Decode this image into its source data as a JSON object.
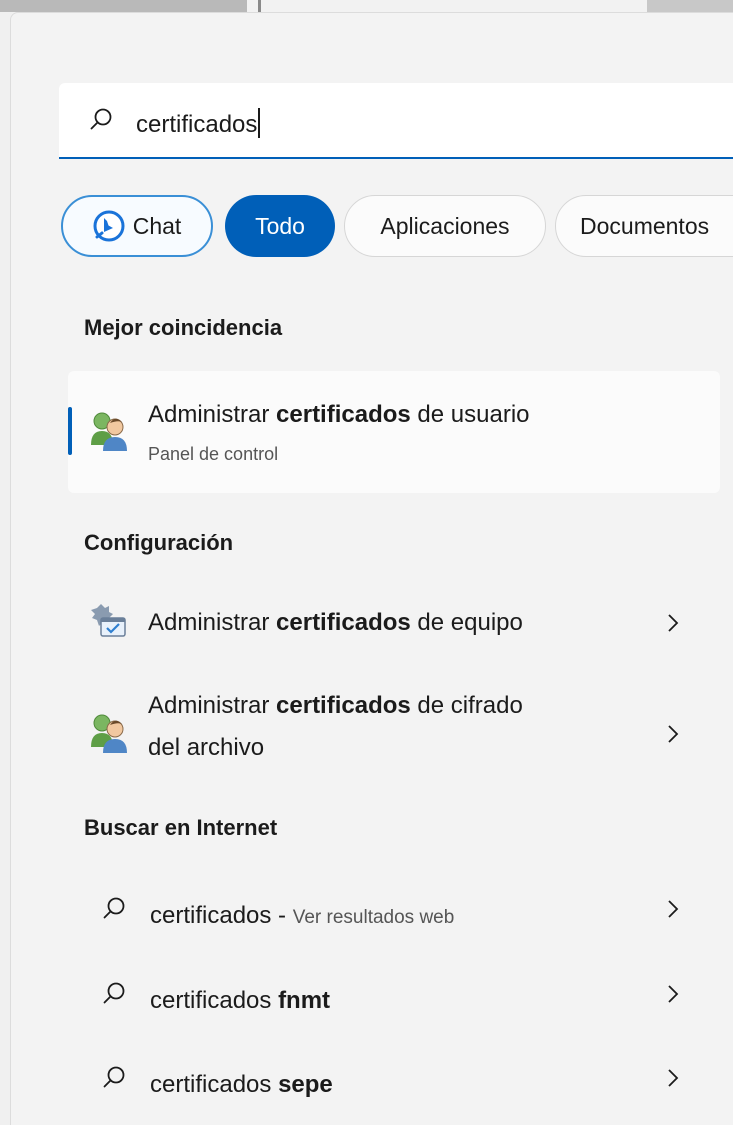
{
  "search": {
    "query": "certificados",
    "icon": "search-icon"
  },
  "filters": [
    {
      "label": "Chat",
      "icon": "bing-chat-icon",
      "active": false
    },
    {
      "label": "Todo",
      "active": true
    },
    {
      "label": "Aplicaciones",
      "active": false
    },
    {
      "label": "Documentos",
      "active": false
    }
  ],
  "best_match": {
    "heading": "Mejor coincidencia",
    "item": {
      "pre": "Administrar ",
      "bold": "certificados",
      "post": " de usuario",
      "subtitle": "Panel de control",
      "icon": "users-icon"
    }
  },
  "settings": {
    "heading": "Configuración",
    "items": [
      {
        "pre": "Administrar ",
        "bold": "certificados",
        "post": " de equipo",
        "icon": "computer-certificate-icon"
      },
      {
        "pre": "Administrar ",
        "bold": "certificados",
        "post": " de cifrado",
        "line2": "del archivo",
        "icon": "users-icon"
      }
    ]
  },
  "web": {
    "heading": "Buscar en Internet",
    "items": [
      {
        "text": "certificados",
        "suffix": " - ",
        "muted": "Ver resultados web",
        "icon": "search-icon"
      },
      {
        "text": "certificados ",
        "bold": "fnmt",
        "icon": "search-icon"
      },
      {
        "text": "certificados ",
        "bold": "sepe",
        "icon": "search-icon"
      }
    ]
  },
  "colors": {
    "accent": "#005fb8",
    "panel": "#f3f3f3",
    "card": "#fbfbfb"
  }
}
